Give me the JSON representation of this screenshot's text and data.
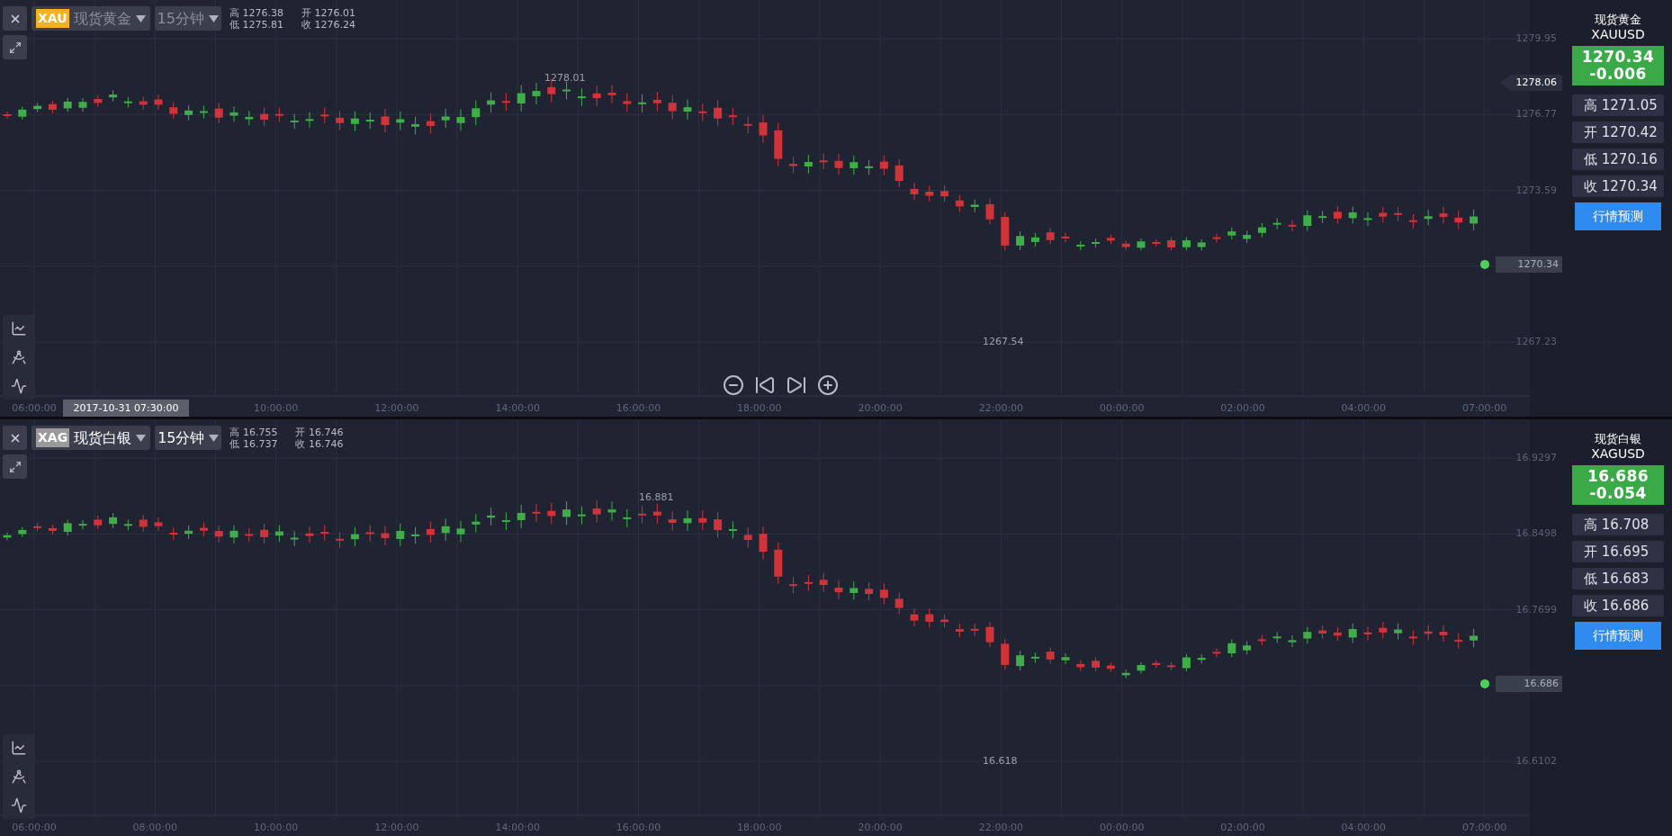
{
  "panels": [
    {
      "symbol_code": "XAU",
      "color": "#f5b21e",
      "name": "现货黄金",
      "active": false,
      "interval": "15分钟",
      "header_stats": [
        "高 1276.38",
        "开 1276.01",
        "低 1275.81",
        "收 1276.24"
      ],
      "y_ticks": [
        "1279.95",
        "1276.77",
        "1273.59",
        "1267.23"
      ],
      "price_tag": "1278.06",
      "last_price": "1270.34",
      "high_label": "1278.01",
      "low_label": "1267.54",
      "cursor_time": "2017-10-31 07:30:00",
      "x_labels": [
        "06:00:00",
        "10:00:00",
        "12:00:00",
        "14:00:00",
        "16:00:00",
        "18:00:00",
        "20:00:00",
        "22:00:00",
        "00:00:00",
        "02:00:00",
        "04:00:00",
        "07:00:00"
      ],
      "nav_controls": true,
      "quote": {
        "name": "现货黄金",
        "code": "XAUUSD",
        "price": "1270.34",
        "change": "-0.006",
        "ohlc": [
          "高 1271.05",
          "开 1270.42",
          "低 1270.16",
          "收 1270.34"
        ],
        "button": "行情预测"
      }
    },
    {
      "symbol_code": "XAG",
      "color": "#9a9a9a",
      "name": "现货白银",
      "active": true,
      "interval": "15分钟",
      "header_stats": [
        "高 16.755",
        "开 16.746",
        "低 16.737",
        "收 16.746"
      ],
      "y_ticks": [
        "16.9297",
        "16.8498",
        "16.7699",
        "16.6102"
      ],
      "last_price": "16.686",
      "high_label": "16.881",
      "low_label": "16.618",
      "x_labels": [
        "06:00:00",
        "08:00:00",
        "10:00:00",
        "12:00:00",
        "14:00:00",
        "16:00:00",
        "18:00:00",
        "20:00:00",
        "22:00:00",
        "00:00:00",
        "02:00:00",
        "04:00:00",
        "07:00:00"
      ],
      "nav_controls": false,
      "quote": {
        "name": "现货白银",
        "code": "XAGUSD",
        "price": "16.686",
        "change": "-0.054",
        "ohlc": [
          "高 16.708",
          "开 16.695",
          "低 16.683",
          "收 16.686"
        ],
        "button": "行情预测"
      }
    }
  ]
}
